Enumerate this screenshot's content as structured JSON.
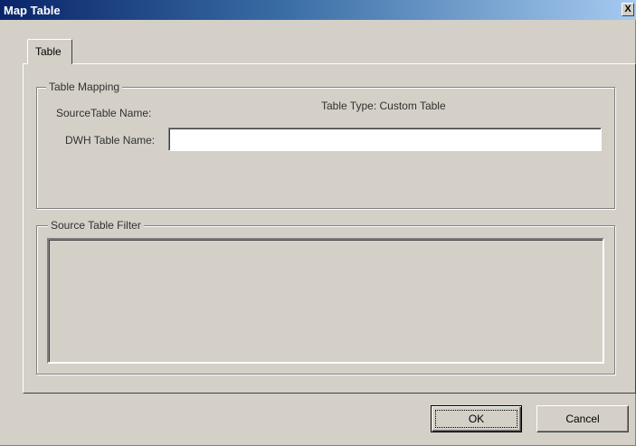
{
  "window": {
    "title": "Map Table",
    "close_glyph": "X"
  },
  "tabs": [
    {
      "label": "Table",
      "selected": true
    }
  ],
  "table_mapping": {
    "legend": "Table Mapping",
    "source_table_label": "SourceTable Name:",
    "table_type_label": "Table Type: Custom Table",
    "dwh_table_label": "DWH Table Name:",
    "dwh_table_value": ""
  },
  "source_filter": {
    "legend": "Source Table Filter"
  },
  "buttons": {
    "ok_label": "OK",
    "cancel_label": "Cancel"
  },
  "colors": {
    "dialog_face": "#d4d0c8",
    "title_gradient_start": "#0a246a",
    "title_gradient_end": "#a6caf0"
  }
}
